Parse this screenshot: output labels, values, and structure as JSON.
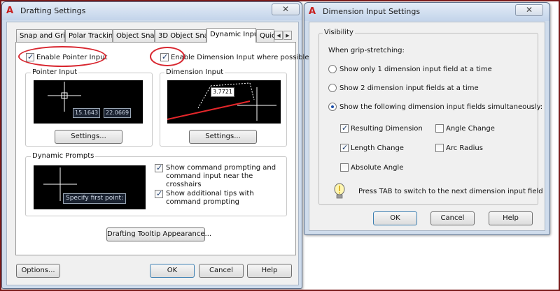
{
  "drafting": {
    "title": "Drafting Settings",
    "tabs": [
      "Snap and Grid",
      "Polar Tracking",
      "Object Snap",
      "3D Object Snap",
      "Dynamic Input",
      "Quic"
    ],
    "active_tab": "Dynamic Input",
    "enable_pointer_input": "Enable Pointer Input",
    "enable_dimension_input": "Enable Dimension Input where possible",
    "pointer_input_group": "Pointer Input",
    "dimension_input_group": "Dimension Input",
    "pointer_values": [
      "15.1643",
      "22.0669"
    ],
    "dimension_value": "3.7721",
    "settings_label": "Settings...",
    "dynamic_prompts_group": "Dynamic Prompts",
    "specify_first_point": "Specify first point:",
    "show_command_prompting": "Show command prompting and command input near the crosshairs",
    "show_additional_tips": "Show additional tips with command prompting",
    "tooltip_appearance": "Drafting Tooltip Appearance...",
    "options": "Options...",
    "ok": "OK",
    "cancel": "Cancel",
    "help": "Help"
  },
  "dimension": {
    "title": "Dimension Input Settings",
    "visibility": "Visibility",
    "when_grip": "When grip-stretching:",
    "radio1": "Show only 1 dimension input field at a time",
    "radio2": "Show 2 dimension input fields at a time",
    "radio3": "Show the following dimension input fields simultaneously:",
    "resulting_dimension": "Resulting Dimension",
    "angle_change": "Angle Change",
    "length_change": "Length Change",
    "arc_radius": "Arc Radius",
    "absolute_angle": "Absolute Angle",
    "tab_hint": "Press TAB to switch to the next dimension input field",
    "ok": "OK",
    "cancel": "Cancel",
    "help": "Help"
  },
  "colors": {
    "annotation": "#d8262f",
    "titlebar": "#c3d4ea",
    "preview_bg": "#000000"
  }
}
